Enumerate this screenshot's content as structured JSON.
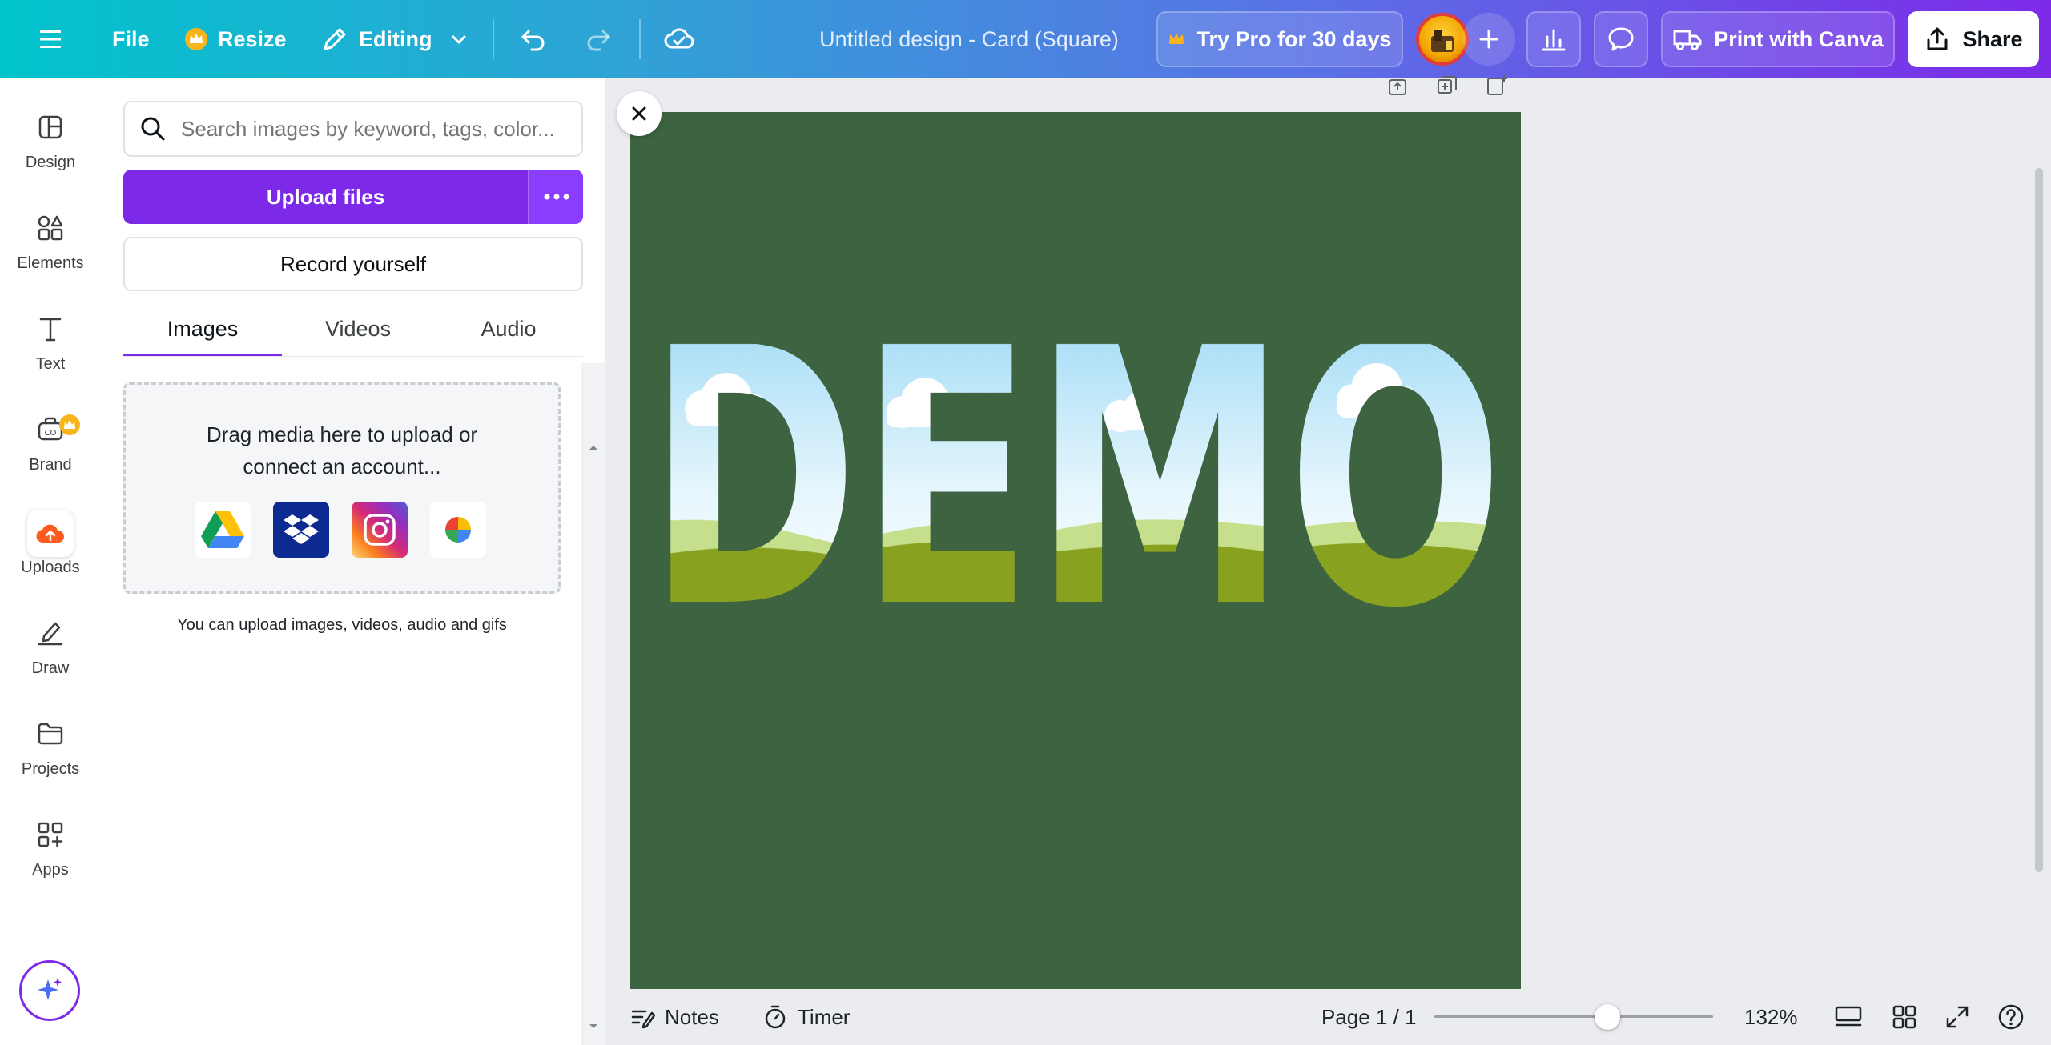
{
  "topbar": {
    "file_label": "File",
    "resize_label": "Resize",
    "mode_label": "Editing",
    "doc_title": "Untitled design - Card (Square)",
    "try_pro_label": "Try Pro for 30 days",
    "print_label": "Print with Canva",
    "share_label": "Share"
  },
  "rail": {
    "items": [
      {
        "label": "Design",
        "icon": "design-icon"
      },
      {
        "label": "Elements",
        "icon": "elements-icon"
      },
      {
        "label": "Text",
        "icon": "text-icon"
      },
      {
        "label": "Brand",
        "icon": "brand-icon"
      },
      {
        "label": "Uploads",
        "icon": "uploads-icon"
      },
      {
        "label": "Draw",
        "icon": "draw-icon"
      },
      {
        "label": "Projects",
        "icon": "projects-icon"
      },
      {
        "label": "Apps",
        "icon": "apps-icon"
      }
    ]
  },
  "panel": {
    "search_placeholder": "Search images by keyword, tags, color...",
    "upload_label": "Upload files",
    "record_label": "Record yourself",
    "tabs": [
      {
        "label": "Images",
        "active": true
      },
      {
        "label": "Videos",
        "active": false
      },
      {
        "label": "Audio",
        "active": false
      }
    ],
    "drop_text": "Drag media here to upload or connect an account...",
    "services": [
      "google-drive-icon",
      "dropbox-icon",
      "instagram-icon",
      "google-photos-icon"
    ],
    "hint": "You can upload images, videos, audio and gifs"
  },
  "canvas": {
    "text": "DEMO",
    "background_color": "#3d6340"
  },
  "bottombar": {
    "notes_label": "Notes",
    "timer_label": "Timer",
    "page_label": "Page 1 / 1",
    "zoom_label": "132%",
    "zoom_fraction": 0.62
  },
  "colors": {
    "accent": "#7d2ae8",
    "teal": "#00c4cc",
    "canvas_green": "#3d6340"
  }
}
